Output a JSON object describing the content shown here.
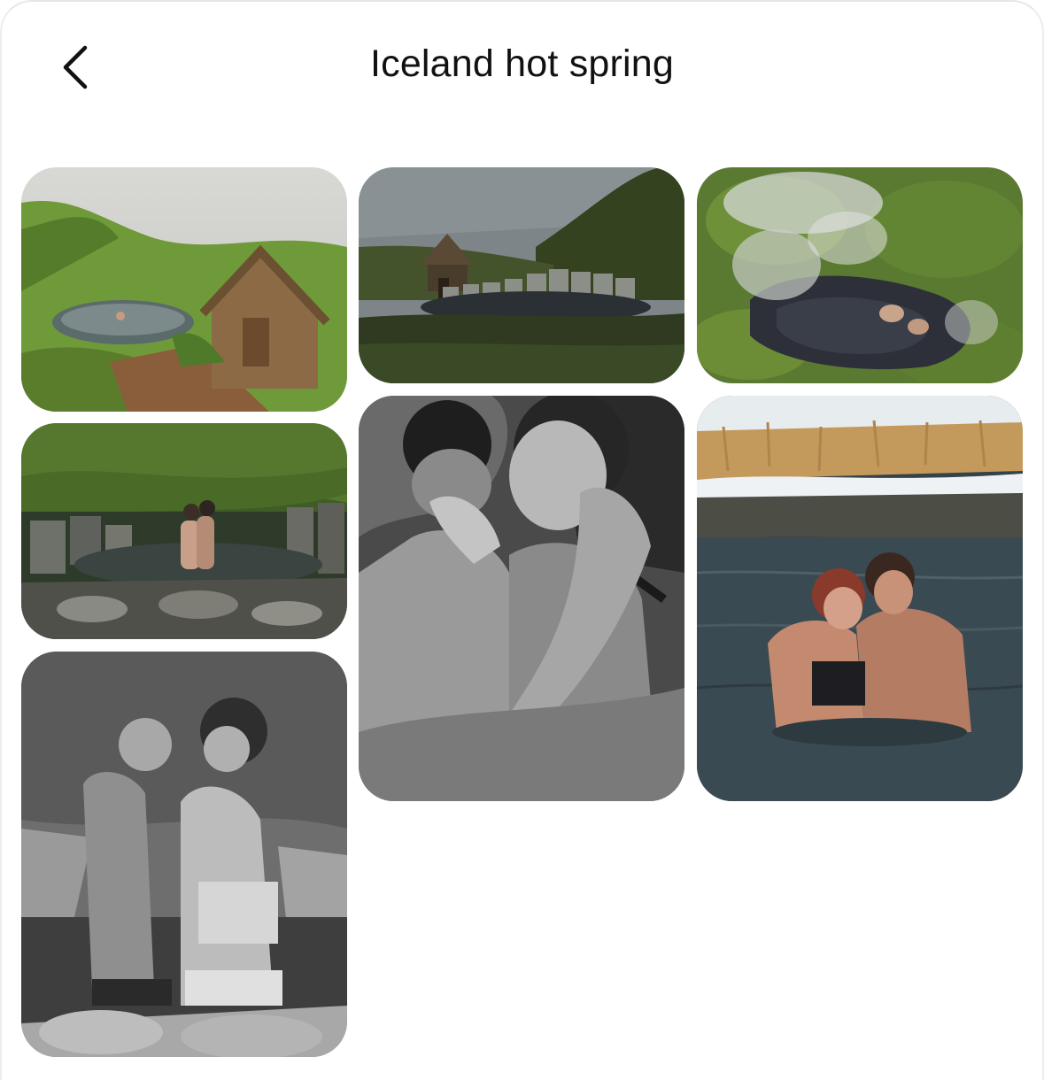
{
  "header": {
    "title": "Iceland hot spring",
    "back_icon": "chevron-left-icon"
  },
  "pins": [
    {
      "id": "pin-turf-hut-valley",
      "scene": "green valley, turf-roof hut beside small hot pool, bather in water",
      "palette": [
        "#6f9a3a",
        "#c9c9c4",
        "#7b5a3c"
      ]
    },
    {
      "id": "pin-hut-stone-pool",
      "scene": "dusky hillside, turf hut, stone-walled hot pool",
      "palette": [
        "#3d4a2a",
        "#7d8588",
        "#2a2f2a"
      ]
    },
    {
      "id": "pin-steaming-pool-aerial",
      "scene": "aerial view of steaming pool among mossy rocks",
      "palette": [
        "#6a8a3a",
        "#c8ccc8",
        "#2d3038"
      ]
    },
    {
      "id": "pin-couple-in-stone-pool",
      "scene": "couple embracing in stone-ringed pool, green hillside",
      "palette": [
        "#4d6a2c",
        "#6a6a66",
        "#262b22"
      ]
    },
    {
      "id": "pin-couple-closeup-bw",
      "scene": "black and white close-up of couple embracing",
      "palette": [
        "#3a3a3a",
        "#9a9a9a",
        "#1e1e1e"
      ]
    },
    {
      "id": "pin-couple-river-golden",
      "scene": "couple in river water, golden grass and snow behind",
      "palette": [
        "#c49a5c",
        "#e7ecef",
        "#34424a"
      ]
    },
    {
      "id": "pin-couple-pool-bw",
      "scene": "black and white couple standing in pool by rocks",
      "palette": [
        "#6e6e6e",
        "#a9a9a9",
        "#2a2a2a"
      ]
    }
  ]
}
